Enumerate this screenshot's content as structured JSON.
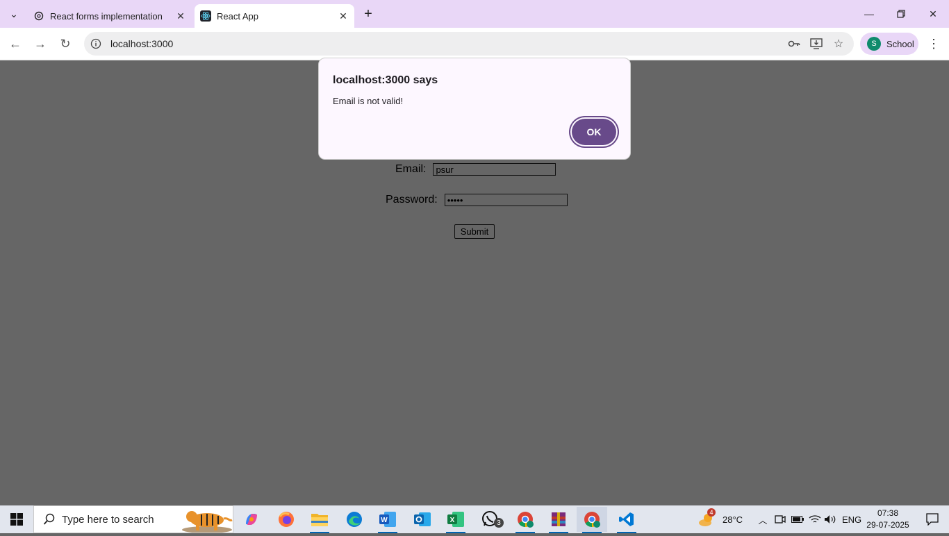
{
  "browser": {
    "tabs": [
      {
        "title": "React forms implementation",
        "active": false
      },
      {
        "title": "React App",
        "active": true
      }
    ],
    "address": "localhost:3000",
    "profile": {
      "initial": "S",
      "name": "School"
    }
  },
  "form": {
    "email_label": "Email:",
    "email_value": "psur",
    "password_label": "Password:",
    "password_value": "•••••",
    "submit_label": "Submit"
  },
  "dialog": {
    "title": "localhost:3000 says",
    "message": "Email is not valid!",
    "ok_label": "OK"
  },
  "taskbar": {
    "search_placeholder": "Type here to search",
    "whatsapp_badge": "3",
    "weather": {
      "temp": "28°C",
      "badge": "4"
    },
    "language": "ENG",
    "time": "07:38",
    "date": "29-07-2025"
  },
  "colors": {
    "tabstrip": "#e9d7f7",
    "page_dim": "#666666",
    "dialog_bg": "#fdf7ff",
    "ok_button": "#684a8a",
    "taskbar": "#e2e6ee"
  }
}
